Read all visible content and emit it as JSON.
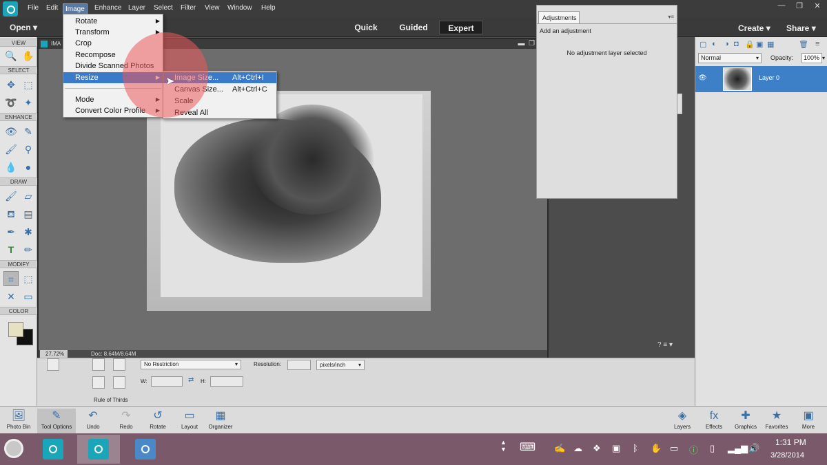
{
  "menubar": {
    "items": [
      "File",
      "Edit",
      "Image",
      "Enhance",
      "Layer",
      "Select",
      "Filter",
      "View",
      "Window",
      "Help"
    ],
    "active": "Image"
  },
  "modebar": {
    "open": "Open",
    "tabs": [
      "Quick",
      "Guided",
      "Expert"
    ],
    "active_tab": "Expert",
    "create": "Create",
    "share": "Share"
  },
  "toolbox": {
    "sections": [
      "VIEW",
      "SELECT",
      "ENHANCE",
      "DRAW",
      "MODIFY",
      "COLOR"
    ],
    "foreground_color": "#e7e1c2",
    "background_color": "#111111"
  },
  "image_menu": {
    "items": [
      "Rotate",
      "Transform",
      "Crop",
      "Recompose",
      "Divide Scanned Photos",
      "Resize",
      "Mode",
      "Convert Color Profile"
    ],
    "highlighted": "Resize"
  },
  "resize_menu": {
    "items": [
      {
        "label": "Image Size...",
        "shortcut": "Alt+Ctrl+I"
      },
      {
        "label": "Canvas Size...",
        "shortcut": "Alt+Ctrl+C"
      },
      {
        "label": "Scale",
        "shortcut": ""
      },
      {
        "label": "Reveal All",
        "shortcut": ""
      }
    ],
    "highlighted": "Image Size..."
  },
  "document": {
    "tab_title": "IMA",
    "zoom": "27.72%",
    "doc_size": "Doc: 8.64M/8.64M"
  },
  "adjustments": {
    "tab": "Adjustments",
    "subtitle": "Add an adjustment",
    "empty": "No adjustment layer selected"
  },
  "layers": {
    "blend_mode": "Normal",
    "opacity_label": "Opacity:",
    "opacity": "100%",
    "layer_name": "Layer 0"
  },
  "tool_options": {
    "crop_preset": "No Restriction",
    "w_label": "W:",
    "h_label": "H:",
    "resolution_label": "Resolution:",
    "resolution_unit": "pixels/inch",
    "overlay_label": "Rule of Thirds"
  },
  "app_taskbar": {
    "left": [
      "Photo Bin",
      "Tool Options",
      "Undo",
      "Redo",
      "Rotate",
      "Layout",
      "Organizer"
    ],
    "right": [
      "Layers",
      "Effects",
      "Graphics",
      "Favorites",
      "More"
    ]
  },
  "clock": {
    "time": "1:31 PM",
    "date": "3/28/2014"
  }
}
